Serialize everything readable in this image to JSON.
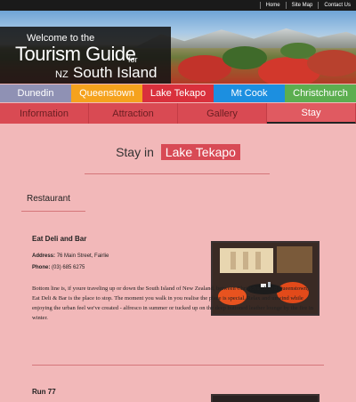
{
  "topnav": {
    "links": [
      "Home",
      "Site Map",
      "Contact Us"
    ]
  },
  "banner": {
    "line1": "Welcome to the",
    "line2": "Tourism Guide",
    "line3": "for",
    "line4": "NZ",
    "line5": "South Island"
  },
  "regions": [
    {
      "label": "Dunedin",
      "color": "#8f91b4"
    },
    {
      "label": "Queenstown",
      "color": "#f5a21d"
    },
    {
      "label": "Lake Tekapo",
      "color": "#d9303c"
    },
    {
      "label": "Mt Cook",
      "color": "#1c8fe0"
    },
    {
      "label": "Christchurch",
      "color": "#5cae50"
    }
  ],
  "tabs": [
    "Information",
    "Attraction",
    "Gallery",
    "Stay"
  ],
  "page": {
    "heading_prefix": "Stay in",
    "heading_place": "Lake Tekapo",
    "section": "Restaurant"
  },
  "entries": [
    {
      "title": "Eat Deli and Bar",
      "address_label": "Address:",
      "address": "76 Main Street, Fairlie",
      "phone_label": "Phone:",
      "phone": "(03) 685 6275",
      "description": "Bottom line is, if youre traveling up or down the South Island of New Zealand, between Christchurch and Queenstown, Eat Deli & Bar is the place to stop. The moment you walk in you realise the place is special. Relax and unwind while enjoying the urban feel we've created - alfresco in summer or tucked up on the deep buttoned leather lounge by the fire in winter."
    },
    {
      "title": "Run 77"
    }
  ]
}
